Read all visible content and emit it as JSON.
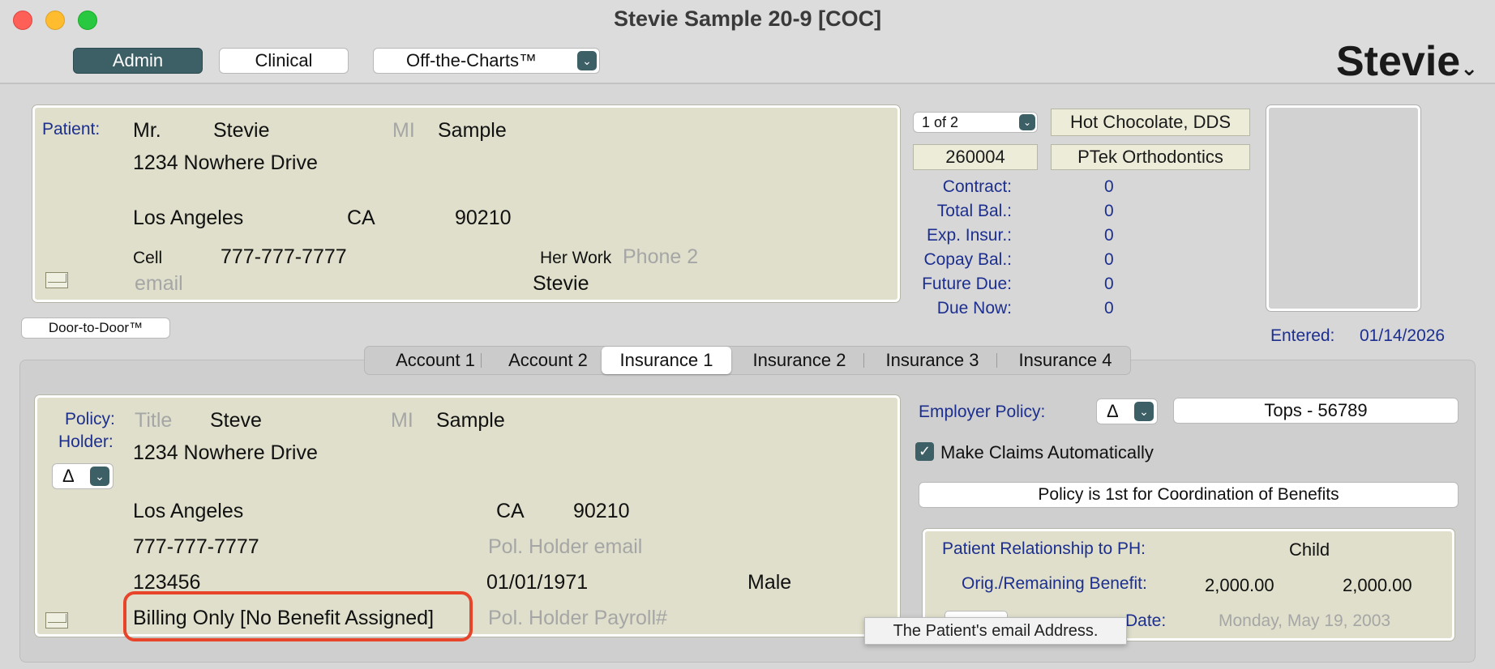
{
  "window": {
    "title": "Stevie Sample 20-9 [COC]"
  },
  "toolbar": {
    "admin": "Admin",
    "clinical": "Clinical",
    "off_the_charts": "Off-the-Charts™",
    "brand": "Stevie"
  },
  "patient": {
    "label": "Patient:",
    "prefix": "Mr.",
    "first": "Stevie",
    "mi_placeholder": "MI",
    "last": "Sample",
    "address": "1234 Nowhere Drive",
    "city": "Los Angeles",
    "state": "CA",
    "zip": "90210",
    "phone1_label": "Cell",
    "phone1": "777-777-7777",
    "phone2_label": "Her Work",
    "phone2_placeholder": "Phone 2",
    "email_placeholder": "email",
    "nickname": "Stevie"
  },
  "account": {
    "selector": "1 of 2",
    "doctor": "Hot Chocolate, DDS",
    "account_no": "260004",
    "practice": "PTek Orthodontics",
    "summary": [
      {
        "label": "Contract:",
        "value": "0"
      },
      {
        "label": "Total Bal.:",
        "value": "0"
      },
      {
        "label": "Exp. Insur.:",
        "value": "0"
      },
      {
        "label": "Copay Bal.:",
        "value": "0"
      },
      {
        "label": "Future Due:",
        "value": "0"
      },
      {
        "label": "Due Now:",
        "value": "0"
      }
    ],
    "entered_label": "Entered:",
    "entered_date": "01/14/2026"
  },
  "door_to_door": "Door-to-Door™",
  "tabs": [
    "Account 1",
    "Account 2",
    "Insurance 1",
    "Insurance 2",
    "Insurance 3",
    "Insurance 4"
  ],
  "policy_holder": {
    "label1": "Policy:",
    "label2": "Holder:",
    "title_placeholder": "Title",
    "first": "Steve",
    "mi_placeholder": "MI",
    "last": "Sample",
    "delta": "Δ",
    "address": "1234 Nowhere Drive",
    "city": "Los Angeles",
    "state": "CA",
    "zip": "90210",
    "phone": "777-777-7777",
    "email_placeholder": "Pol. Holder email",
    "id": "123456",
    "dob": "01/01/1971",
    "gender": "Male",
    "billing": "Billing Only [No Benefit Assigned]",
    "payroll_placeholder": "Pol. Holder Payroll#"
  },
  "insurance": {
    "employer_policy_label": "Employer Policy:",
    "employer_delta": "Δ",
    "employer_value": "Tops - 56789",
    "make_claims_label": "Make Claims Automatically",
    "make_claims_checked": true,
    "coordination": "Policy is 1st for Coordination of Benefits",
    "relationship_label": "Patient Relationship to PH:",
    "relationship_value": "Child",
    "benefit_label": "Orig./Remaining Benefit:",
    "benefit_original": "2,000.00",
    "benefit_remaining": "2,000.00",
    "next_claim_label": "Date:",
    "next_claim_value": "Monday, May 19, 2003"
  },
  "tooltip": "The Patient's email Address.",
  "colors": {
    "accent": "#3d5f66",
    "label_blue": "#1c2f8f",
    "panel": "#dfdfcb",
    "highlight": "#e8442a"
  }
}
